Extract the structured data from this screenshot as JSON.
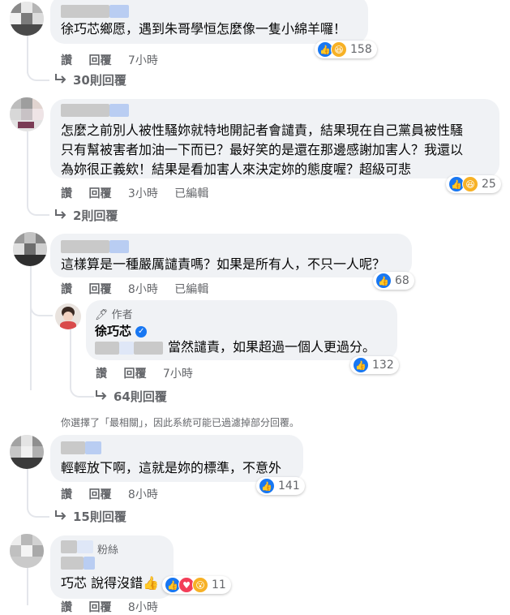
{
  "actions": {
    "like": "讚",
    "reply": "回覆",
    "edited": "已編輯"
  },
  "comments": [
    {
      "text": [
        "徐巧芯鄉愿，遇到朱哥學恒怎麼像一隻小綿羊囉！"
      ],
      "time": "7小時",
      "reactions": "158",
      "replies": "30則回覆"
    },
    {
      "text": [
        "怎麼之前別人被性騷妳就特地開記者會譴責，結果現在自己黨員被性騷",
        "只有幫被害者加油一下而已？最好笑的是還在那邊感謝加害人？我還以",
        "為妳很正義欸！結果是看加害人來決定妳的態度喔？超級可悲"
      ],
      "time": "3小時",
      "reactions": "25",
      "replies": "2則回覆"
    },
    {
      "text": [
        "這樣算是一種嚴厲譴責嗎？如果是所有人，不只一人呢？"
      ],
      "time": "8小時",
      "reactions": "68"
    },
    {
      "text": [
        "輕輕放下啊，這就是妳的標準，不意外"
      ],
      "time": "8小時",
      "reactions": "141",
      "replies": "15則回覆"
    },
    {
      "badge": "粉絲",
      "text": [
        "巧芯 說得沒錯👍"
      ],
      "time": "8小時",
      "reactions": "11"
    }
  ],
  "author_reply": {
    "badge": "作者",
    "name": "徐巧芯",
    "text": "當然譴責，如果超過一個人更過分。",
    "time": "7小時",
    "reactions": "132",
    "replies": "64則回覆"
  },
  "notice": "你選擇了「最相關」，因此系統可能已過濾掉部分回覆。"
}
